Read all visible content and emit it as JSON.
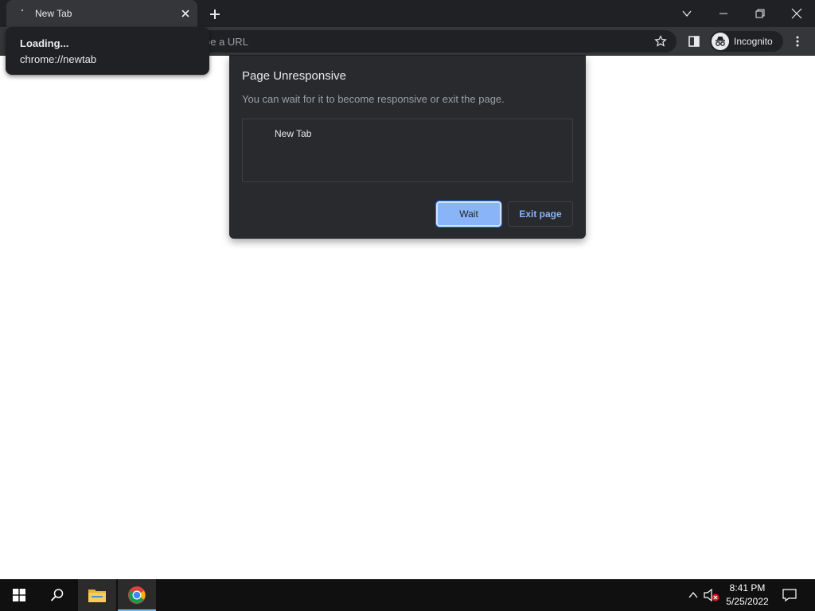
{
  "browser": {
    "tab": {
      "title": "New Tab"
    },
    "omnibox": {
      "placeholder_partial": "pe a URL"
    },
    "profile": {
      "label": "Incognito"
    }
  },
  "hover_card": {
    "title": "Loading...",
    "url": "chrome://newtab"
  },
  "dialog": {
    "title": "Page Unresponsive",
    "description": "You can wait for it to become responsive or exit the page.",
    "pages": [
      "New Tab"
    ],
    "wait_label": "Wait",
    "exit_label": "Exit page"
  },
  "taskbar": {
    "time": "8:41 PM",
    "date": "5/25/2022",
    "pinned": [
      "file-explorer-icon",
      "chrome-icon"
    ]
  },
  "colors": {
    "frame": "#202124",
    "toolbar": "#35363a",
    "dialog_bg": "#292a2d",
    "accent": "#8ab4f8",
    "taskbar": "#101010"
  }
}
